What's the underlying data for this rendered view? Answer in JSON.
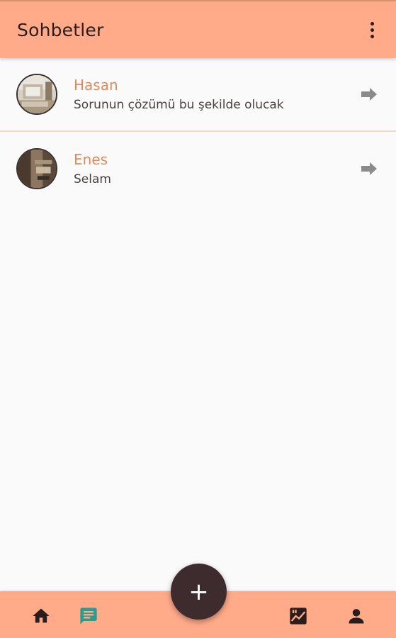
{
  "appbar": {
    "title": "Sohbetler",
    "menu_icon": "more-vert-icon"
  },
  "chats": [
    {
      "name": "Hasan",
      "preview": "Sorunun çözümü bu şekilde olucak",
      "avatar_icon": "avatar-photo",
      "arrow_icon": "arrow-forward-icon"
    },
    {
      "name": "Enes",
      "preview": "Selam",
      "avatar_icon": "avatar-photo",
      "arrow_icon": "arrow-forward-icon"
    }
  ],
  "bottom_nav": {
    "items": [
      {
        "icon": "home-icon",
        "active": false
      },
      {
        "icon": "chat-icon",
        "active": true
      },
      {
        "icon": "stats-icon",
        "active": false
      },
      {
        "icon": "person-icon",
        "active": false
      }
    ],
    "fab_label": "+"
  },
  "colors": {
    "primary": "#ffab8a",
    "accent_text": "#e08a5c",
    "active_nav": "#2a9d8f",
    "fab": "#3d2b2e"
  }
}
